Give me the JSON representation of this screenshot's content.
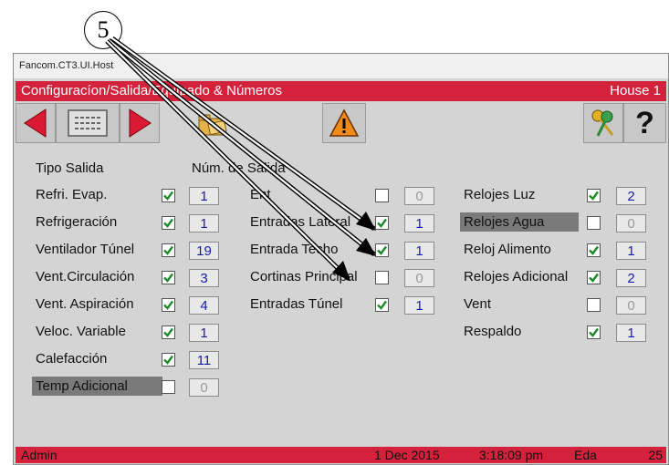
{
  "callout": {
    "number": "5"
  },
  "window": {
    "title": "Fancom.CT3.UI.Host"
  },
  "header": {
    "title": "Configuracíon/Salida/Equipado & Números",
    "house": "House 1"
  },
  "toolbar": {
    "buttons": [
      {
        "icon": "arrow-left-icon"
      },
      {
        "icon": "list-icon"
      },
      {
        "icon": "arrow-right-icon"
      },
      {
        "icon": "folder-icon"
      },
      {
        "icon": "warning-icon"
      },
      {
        "icon": "keys-icon"
      },
      {
        "icon": "help-icon",
        "label": "?"
      }
    ]
  },
  "columns": {
    "output_type": "Tipo Salida",
    "output_number": "Núm. de Salida"
  },
  "left_items": [
    {
      "label": "Refri. Evap.",
      "checked": true,
      "number": "1",
      "highlight": false
    },
    {
      "label": "Refrigeración",
      "checked": true,
      "number": "1",
      "highlight": false
    },
    {
      "label": "Ventilador Túnel",
      "checked": true,
      "number": "19",
      "highlight": false
    },
    {
      "label": "Vent.Circulación",
      "checked": true,
      "number": "3",
      "highlight": false
    },
    {
      "label": "Vent. Aspiración",
      "checked": true,
      "number": "4",
      "highlight": false
    },
    {
      "label": "Veloc. Variable",
      "checked": true,
      "number": "1",
      "highlight": false
    },
    {
      "label": "Calefacción",
      "checked": true,
      "number": "11",
      "highlight": false
    },
    {
      "label": "Temp Adicional",
      "checked": false,
      "number": "0",
      "highlight": true
    }
  ],
  "middle_items": [
    {
      "label": "Ent",
      "checked": false,
      "number": "0"
    },
    {
      "label": "Entradas Lateral",
      "checked": true,
      "number": "1"
    },
    {
      "label": "Entrada Techo",
      "checked": true,
      "number": "1"
    },
    {
      "label": "Cortinas Principal",
      "checked": false,
      "number": "0"
    },
    {
      "label": "Entradas Túnel",
      "checked": true,
      "number": "1"
    }
  ],
  "right_items": [
    {
      "label": "Relojes Luz",
      "checked": true,
      "number": "2",
      "highlight": false
    },
    {
      "label": "Relojes Agua",
      "checked": false,
      "number": "0",
      "highlight": true
    },
    {
      "label": "Reloj Alimento",
      "checked": true,
      "number": "1",
      "highlight": false
    },
    {
      "label": "Relojes Adicional",
      "checked": true,
      "number": "2",
      "highlight": false
    },
    {
      "label": "Vent",
      "checked": false,
      "number": "0",
      "highlight": false
    },
    {
      "label": "Respaldo",
      "checked": true,
      "number": "1",
      "highlight": false
    }
  ],
  "status": {
    "user": "Admin",
    "date": "1 Dec 2015",
    "time": "3:18:09 pm",
    "mode": "Eda",
    "count": "25"
  },
  "colors": {
    "header_red": "#d4213c",
    "number_blue": "#1a1aa8",
    "check_green": "#1d8a2a",
    "arrow_red": "#d91a32"
  }
}
